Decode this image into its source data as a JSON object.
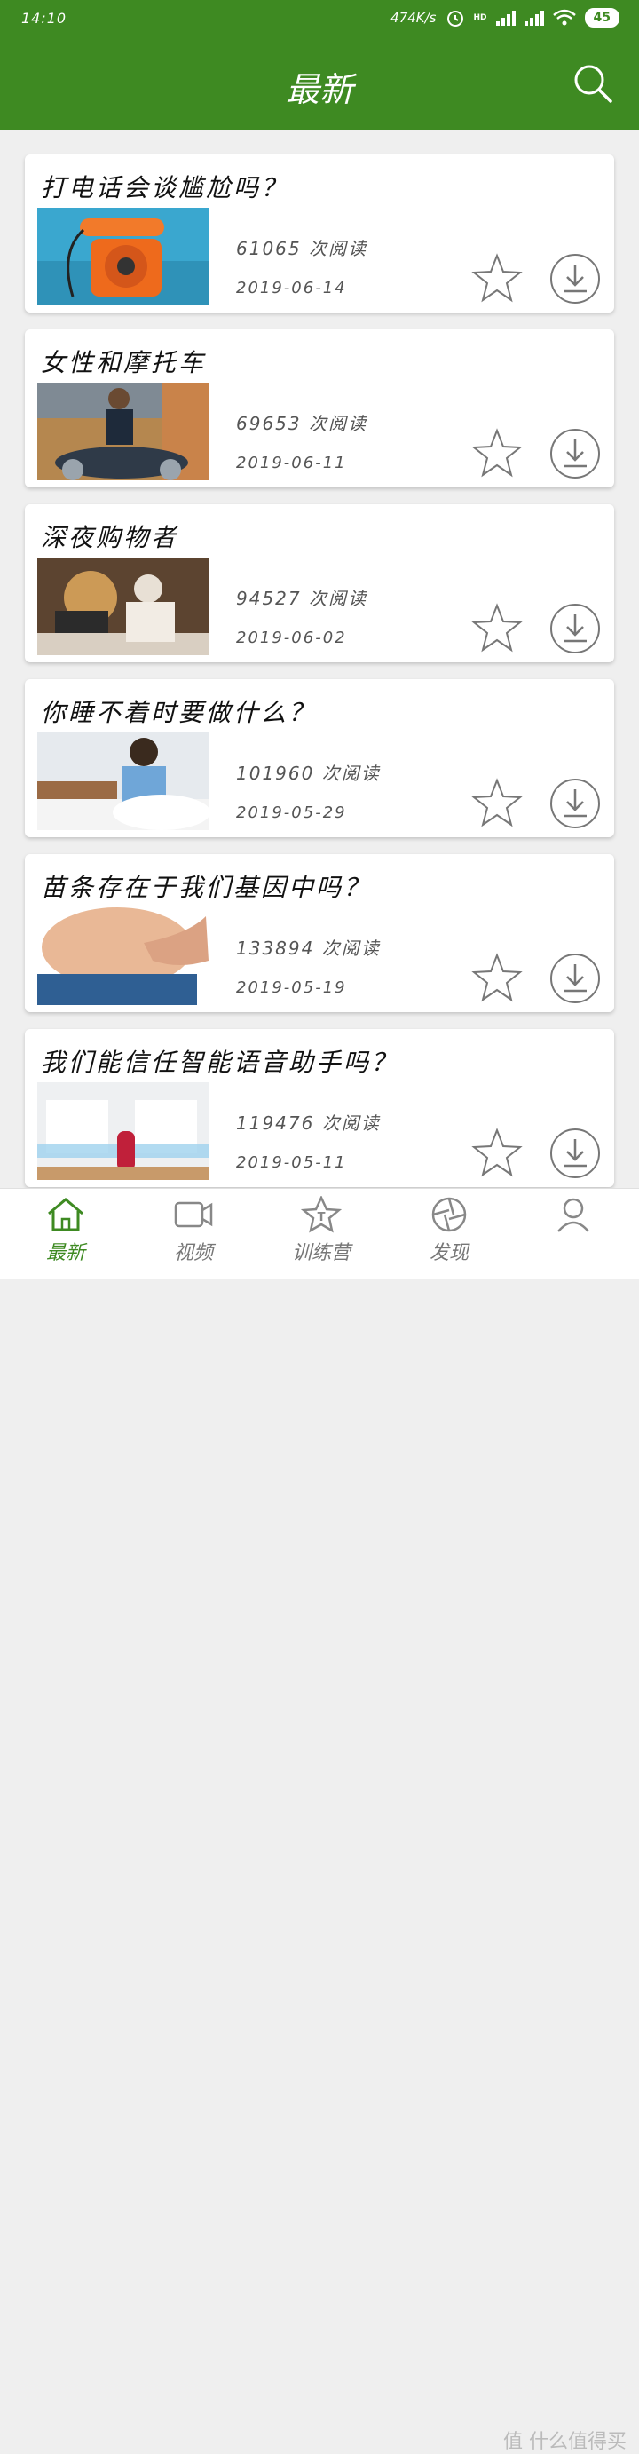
{
  "status": {
    "time": "14:10",
    "speed": "474K/s",
    "hd": "HD",
    "battery": "45"
  },
  "header": {
    "title": "最新"
  },
  "articles": [
    {
      "title": "打电话会谈尴尬吗？",
      "reads": "61065 次阅读",
      "date": "2019-06-14"
    },
    {
      "title": "女性和摩托车",
      "reads": "69653 次阅读",
      "date": "2019-06-11"
    },
    {
      "title": "深夜购物者",
      "reads": "94527 次阅读",
      "date": "2019-06-02"
    },
    {
      "title": "你睡不着时要做什么？",
      "reads": "101960 次阅读",
      "date": "2019-05-29"
    },
    {
      "title": "苗条存在于我们基因中吗？",
      "reads": "133894 次阅读",
      "date": "2019-05-19"
    },
    {
      "title": "我们能信任智能语音助手吗？",
      "reads": "119476 次阅读",
      "date": "2019-05-11"
    }
  ],
  "nav": [
    {
      "label": "最新",
      "icon": "home-icon"
    },
    {
      "label": "视频",
      "icon": "video-icon"
    },
    {
      "label": "训练营",
      "icon": "star-t-icon"
    },
    {
      "label": "发现",
      "icon": "aperture-icon"
    },
    {
      "label": "",
      "icon": "user-icon"
    }
  ],
  "watermark": "值 什么值得买",
  "colors": {
    "primary": "#3e8a22"
  }
}
